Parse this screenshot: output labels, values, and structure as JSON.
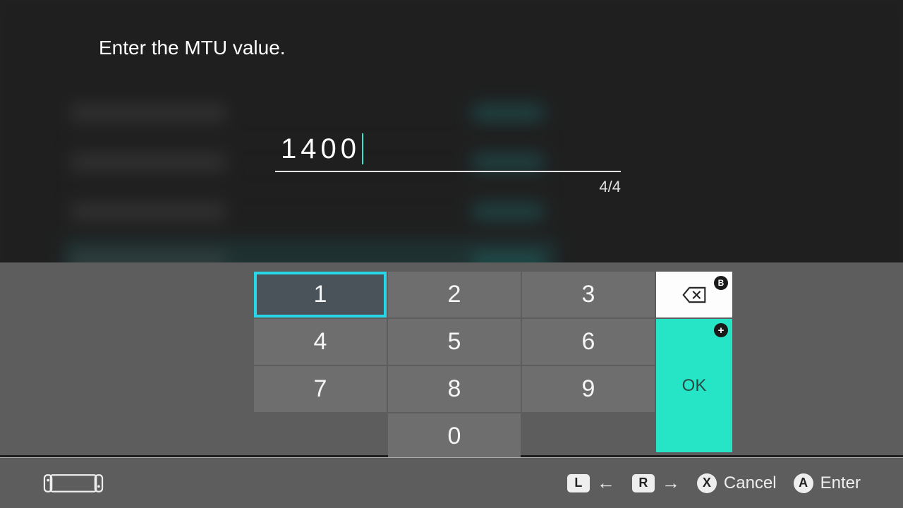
{
  "prompt": "Enter the MTU value.",
  "input": {
    "value": "1400",
    "count": "4/4"
  },
  "keypad": {
    "rows": [
      [
        "1",
        "2",
        "3"
      ],
      [
        "4",
        "5",
        "6"
      ],
      [
        "7",
        "8",
        "9"
      ]
    ],
    "zero": "0",
    "selected": "1",
    "backspace_badge": "B",
    "ok_label": "OK",
    "ok_badge": "+"
  },
  "footer": {
    "L": "L",
    "R": "R",
    "X": "X",
    "A": "A",
    "cancel": "Cancel",
    "enter": "Enter"
  }
}
